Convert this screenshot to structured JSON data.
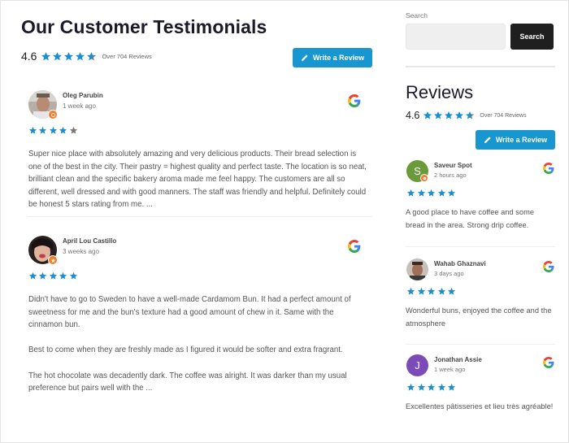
{
  "colors": {
    "accent": "#1896d0",
    "star_filled": "#1a8fd1",
    "star_empty": "#777777",
    "badge": "#f57c28",
    "search_button": "#1f1f1f"
  },
  "main": {
    "title": "Our Customer Testimonials",
    "rating": "4.6",
    "rating_value": 4.6,
    "review_count_text": "Over 704 Reviews",
    "write_review_label": "Write a Review",
    "reviews": [
      {
        "name": "Oleg Parubin",
        "time": "1 week ago",
        "rating": 4,
        "source": "google-icon",
        "paragraphs": [
          "Super nice place with absolutely amazing and very delicious products. Their bread selection is one of the best in the city. Their pastry = highest quality and perfect taste. The location is so neat, brilliant clean and the specific bakery aroma made me feel happy. The customers are all so different, well dressed and with good manners. The staff was friendly and helpful. Definitely could be honest 5 stars rating from me.  ..."
        ]
      },
      {
        "name": "April Lou Castillo",
        "time": "3 weeks ago",
        "rating": 5,
        "source": "google-icon",
        "paragraphs": [
          "Didn't have to go to Sweden to have a well-made Cardamom Bun. It had a perfect amount of sweetness for me and the bun's texture had a good amount of chew in it. Same with the cinnamon bun.",
          "Best to come when they are freshly made as I figured it would be softer and extra fragrant.",
          "The hot chocolate was decadently dark. The coffee was alright. It was darker than my usual preference but pairs well with the  ..."
        ]
      }
    ]
  },
  "sidebar": {
    "search_label": "Search",
    "search_value": "",
    "search_placeholder": "",
    "search_button_label": "Search",
    "title": "Reviews",
    "rating": "4.6",
    "rating_value": 4.6,
    "review_count_text": "Over 704 Reviews",
    "write_review_label": "Write a Review",
    "reviews": [
      {
        "name": "Saveur Spot",
        "time": "2 hours ago",
        "rating": 5,
        "avatar_letter": "S",
        "avatar_color": "#6a9a3a",
        "text": "A good place to have coffee and some bread in the area. Strong drip coffee."
      },
      {
        "name": "Wahab Ghaznavi",
        "time": "3 days ago",
        "rating": 5,
        "avatar_letter": "",
        "avatar_color": "#8a6a5a",
        "text": "Wonderful buns, enjoyed the coffee and the atmosphere"
      },
      {
        "name": "Jonathan Assie",
        "time": "1 week ago",
        "rating": 5,
        "avatar_letter": "J",
        "avatar_color": "#7b4bb8",
        "text": "Excellentes pâtisseries et lieu très agréable!"
      }
    ]
  }
}
